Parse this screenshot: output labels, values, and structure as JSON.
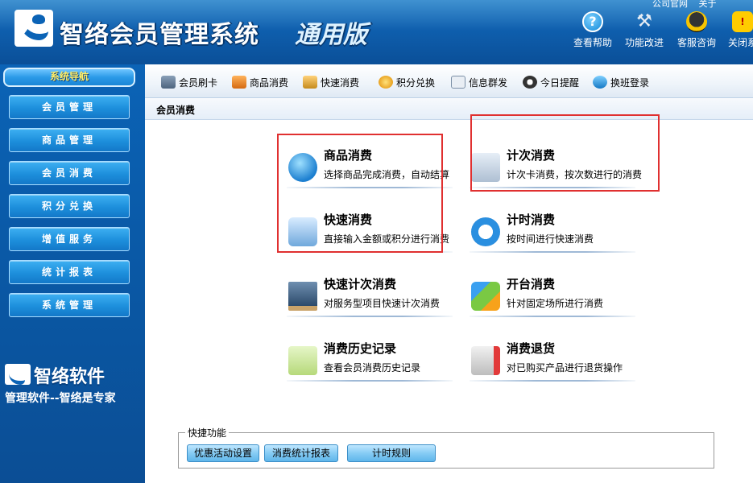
{
  "header": {
    "title": "智络会员管理系统",
    "edition": "通用版",
    "top_links": [
      "公司官网",
      "关于"
    ],
    "tools": [
      {
        "label": "查看帮助",
        "icon": "help-icon"
      },
      {
        "label": "功能改进",
        "icon": "tools-icon"
      },
      {
        "label": "客服咨询",
        "icon": "qq-icon"
      },
      {
        "label": "关闭系",
        "icon": "warning-icon"
      }
    ]
  },
  "sidebar": {
    "heading": "系统导航",
    "items": [
      "会员管理",
      "商品管理",
      "会员消费",
      "积分兑换",
      "增值服务",
      "统计报表",
      "系统管理"
    ],
    "brand": "智络软件",
    "slogan": "管理软件--智络是专家"
  },
  "toolbar": {
    "items": [
      {
        "label": "会员刷卡",
        "icon": "card-icon"
      },
      {
        "label": "商品消费",
        "icon": "bag-icon"
      },
      {
        "label": "快速消费",
        "icon": "fast-icon"
      },
      {
        "label": "积分兑换",
        "icon": "exchange-icon"
      },
      {
        "label": "信息群发",
        "icon": "mail-icon"
      },
      {
        "label": "今日提醒",
        "icon": "clock-icon"
      },
      {
        "label": "换班登录",
        "icon": "shift-icon"
      }
    ]
  },
  "section": {
    "title": "会员消费"
  },
  "tiles": [
    {
      "title": "商品消费",
      "desc": "选择商品完成消费，自动结算",
      "icon": "member-icon"
    },
    {
      "title": "计次消费",
      "desc": "计次卡消费，按次数进行的消费",
      "icon": "count-icon"
    },
    {
      "title": "快速消费",
      "desc": "直接输入金额或积分进行消费",
      "icon": "quick-consume-icon"
    },
    {
      "title": "计时消费",
      "desc": "按时间进行快速消费",
      "icon": "timer-icon"
    },
    {
      "title": "快速计次消费",
      "desc": "对服务型项目快速计次消费",
      "icon": "monitor-icon"
    },
    {
      "title": "开台消费",
      "desc": "针对固定场所进行消费",
      "icon": "arrows-icon"
    },
    {
      "title": "消费历史记录",
      "desc": "查看会员消费历史记录",
      "icon": "notebook-icon"
    },
    {
      "title": "消费退货",
      "desc": "对已购买产品进行退货操作",
      "icon": "return-icon"
    }
  ],
  "quick": {
    "legend": "快捷功能",
    "buttons": [
      "优惠活动设置",
      "消费统计报表",
      "计时规则"
    ]
  },
  "colors": {
    "header_blue": "#0f5fae",
    "sidebar_blue": "#0b63b6",
    "highlight_red": "#e03030"
  }
}
